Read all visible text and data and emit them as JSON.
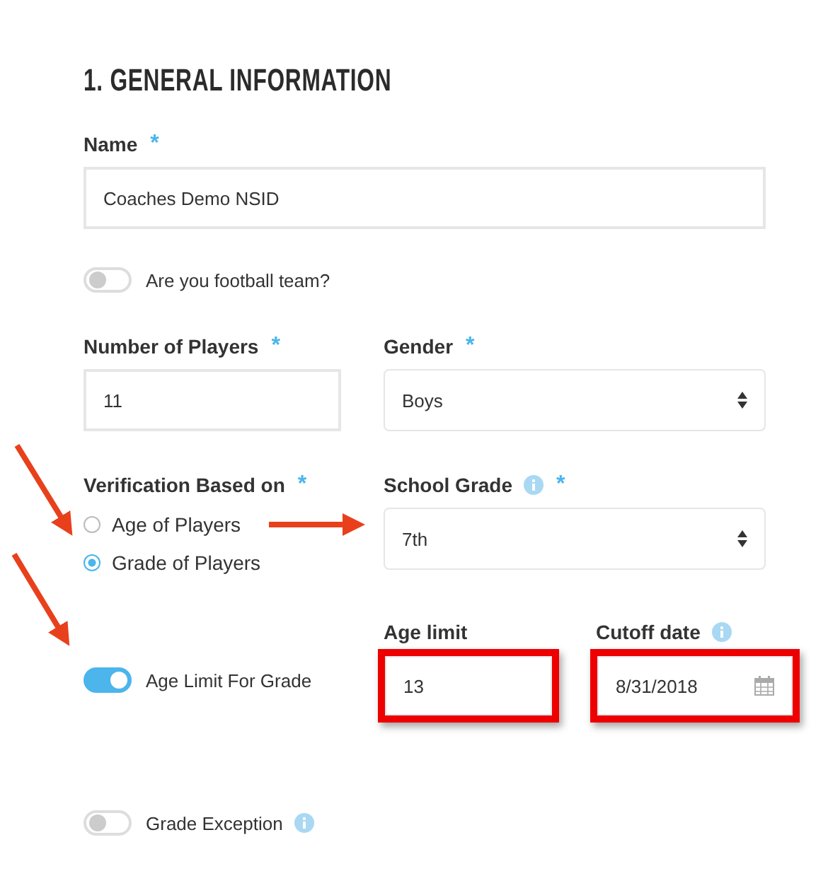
{
  "heading": "1. GENERAL INFORMATION",
  "name_field": {
    "label": "Name",
    "required_mark": "*",
    "value": "Coaches Demo NSID"
  },
  "football_toggle": {
    "label": "Are you football team?",
    "on": false
  },
  "players_field": {
    "label": "Number of Players",
    "required_mark": "*",
    "value": "11"
  },
  "gender_field": {
    "label": "Gender",
    "required_mark": "*",
    "value": "Boys"
  },
  "verification": {
    "label": "Verification Based on",
    "required_mark": "*",
    "options": [
      {
        "label": "Age of Players",
        "selected": false
      },
      {
        "label": "Grade of Players",
        "selected": true
      }
    ]
  },
  "school_grade": {
    "label": "School Grade",
    "info": true,
    "required_mark": "*",
    "value": "7th"
  },
  "age_limit_toggle": {
    "label": "Age Limit For Grade",
    "on": true
  },
  "age_limit": {
    "label": "Age limit",
    "value": "13",
    "highlighted": true
  },
  "cutoff_date": {
    "label": "Cutoff date",
    "info": true,
    "value": "8/31/2018",
    "highlighted": true
  },
  "grade_exception_toggle": {
    "label": "Grade Exception",
    "info": true,
    "on": false
  }
}
